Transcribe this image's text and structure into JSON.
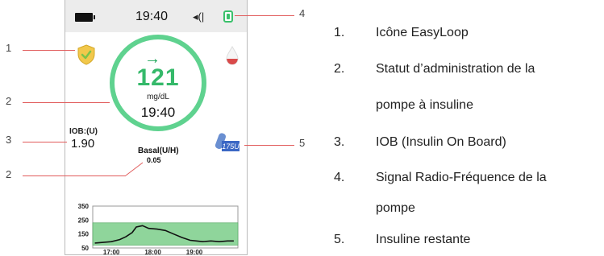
{
  "status_bar": {
    "time": "19:40",
    "vibrate_glyph": "◂(|",
    "battery_icon": "battery-full-icon",
    "signal_icon": "rf-signal-icon"
  },
  "main": {
    "trend_arrow": "→",
    "glucose_value": "121",
    "glucose_unit": "mg/dL",
    "reading_time": "19:40",
    "iob_label": "IOB:(U)",
    "iob_value": "1.90",
    "basal_label": "Basal(U/H)",
    "basal_value": "0.05",
    "insulin_remaining": "175U",
    "easyloop_icon": "shield-check-icon",
    "pump_status_icon": "droplet-icon"
  },
  "chart_data": {
    "type": "line",
    "yticks": [
      "350",
      "250",
      "150",
      "50"
    ],
    "xticks": [
      "17:00",
      "18:00",
      "19:00"
    ],
    "ylim": [
      50,
      350
    ],
    "target_range": [
      70,
      230
    ],
    "x": [
      16.6,
      16.8,
      17.0,
      17.2,
      17.35,
      17.5,
      17.6,
      17.75,
      17.9,
      18.1,
      18.3,
      18.5,
      18.7,
      18.9,
      19.05,
      19.2,
      19.4,
      19.6,
      19.8,
      19.95
    ],
    "values": [
      85,
      90,
      95,
      110,
      130,
      160,
      200,
      210,
      190,
      185,
      175,
      150,
      125,
      105,
      100,
      95,
      100,
      95,
      100,
      100
    ]
  },
  "callouts": [
    "1",
    "2",
    "3",
    "2",
    "4",
    "5"
  ],
  "legend": [
    {
      "num": "1.",
      "text": "Icône EasyLoop"
    },
    {
      "num": "2.",
      "text": "Statut d’administration de la"
    },
    {
      "num": "",
      "text": "pompe à insuline"
    },
    {
      "num": "3.",
      "text": "IOB (Insulin On Board)"
    },
    {
      "num": "4.",
      "text": "Signal Radio-Fréquence de la"
    },
    {
      "num": "",
      "text": "pompe"
    },
    {
      "num": "5.",
      "text": "Insuline restante"
    }
  ],
  "colors": {
    "ring": "#5fd28f",
    "glucose": "#35b96a",
    "callout_line": "#e15b5b",
    "target_band": "#8fd59b"
  }
}
